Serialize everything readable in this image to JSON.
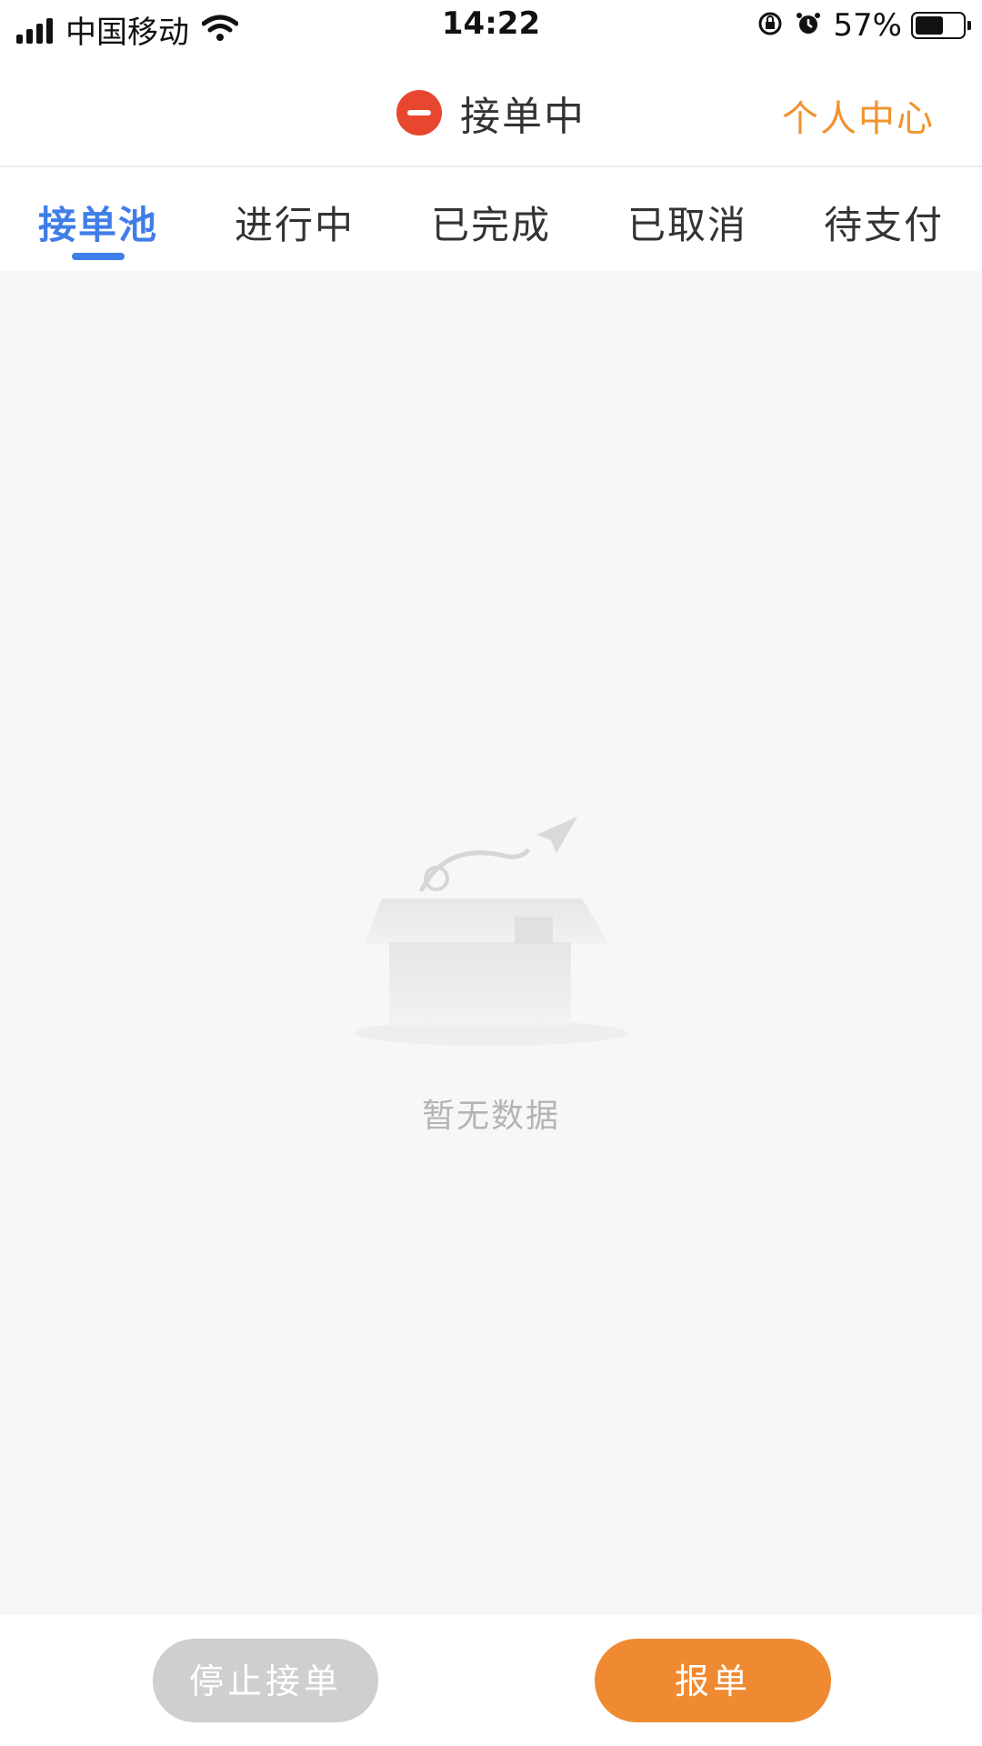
{
  "status_bar": {
    "carrier": "中国移动",
    "time": "14:22",
    "battery_percent": "57%",
    "battery_level": 0.57,
    "icons": [
      "signal-icon",
      "wifi-icon",
      "orientation-lock-icon",
      "alarm-icon",
      "battery-icon"
    ]
  },
  "header": {
    "title": "接单中",
    "status_icon": "stop-icon",
    "status_color": "#e8472f",
    "personal_center": "个人中心",
    "accent_color": "#f0932f"
  },
  "tabs": [
    {
      "label": "接单池",
      "active": true
    },
    {
      "label": "进行中",
      "active": false
    },
    {
      "label": "已完成",
      "active": false
    },
    {
      "label": "已取消",
      "active": false
    },
    {
      "label": "待支付",
      "active": false
    }
  ],
  "tab_active_color": "#3f7ee8",
  "empty_state": {
    "icon": "empty-box-icon",
    "text": "暂无数据"
  },
  "bottom_bar": {
    "stop_label": "停止接单",
    "report_label": "报单",
    "report_color": "#ef8a33"
  }
}
